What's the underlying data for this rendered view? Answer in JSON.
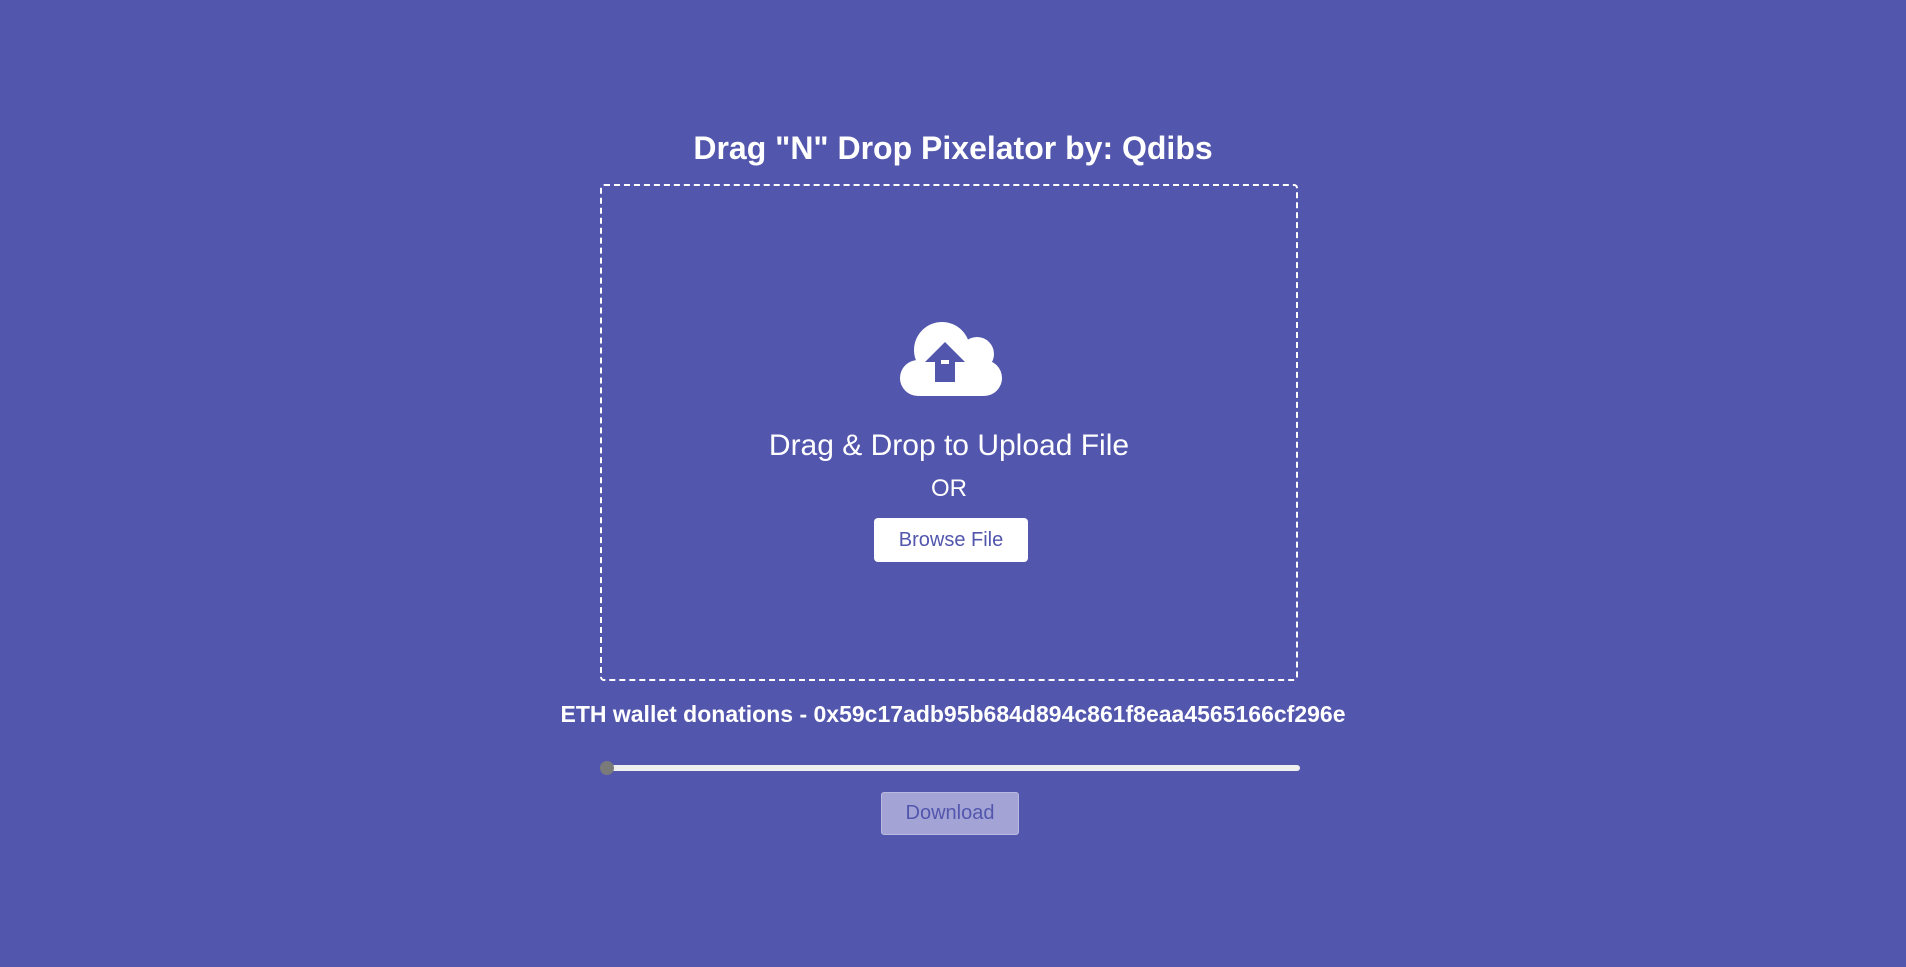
{
  "header": {
    "title": "Drag \"N\" Drop Pixelator by: Qdibs"
  },
  "drop_area": {
    "icon": "cloud-upload-icon",
    "heading": "Drag & Drop to Upload File",
    "or_text": "OR",
    "browse_label": "Browse File"
  },
  "wallet": {
    "text": "ETH wallet donations - 0x59c17adb95b684d894c861f8eaa4565166cf296e"
  },
  "slider": {
    "value_fraction": 0
  },
  "download": {
    "label": "Download",
    "disabled": true
  },
  "colors": {
    "background": "#5256ad",
    "foreground": "#ffffff",
    "download_disabled_bg": "#a3a4d5"
  }
}
